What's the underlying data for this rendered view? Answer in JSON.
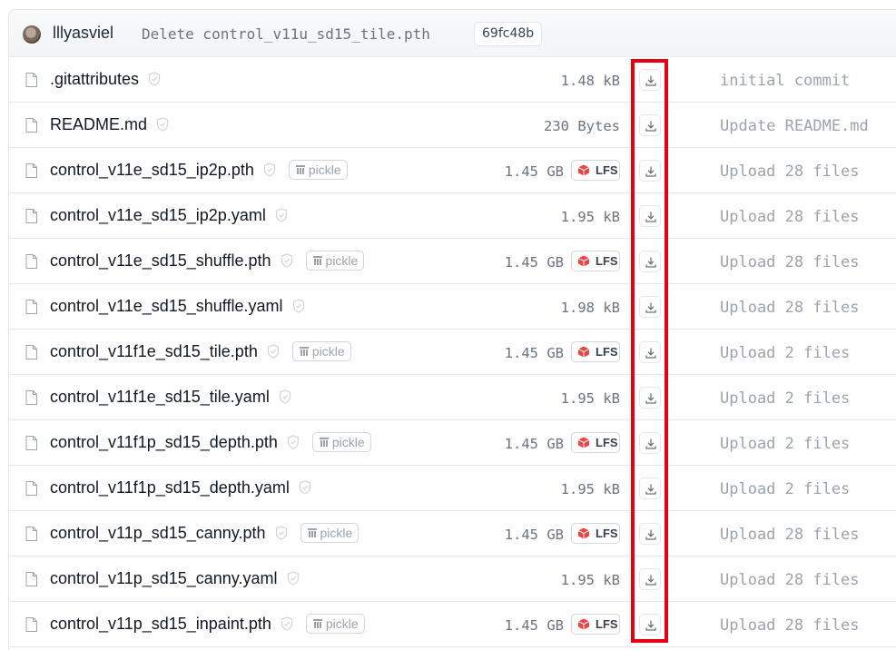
{
  "commit": {
    "author": "lllyasviel",
    "message": "Delete control_v11u_sd15_tile.pth",
    "hash": "69fc48b"
  },
  "badges": {
    "pickle_label": "pickle",
    "lfs_label": "LFS"
  },
  "files": [
    {
      "name": ".gitattributes",
      "size": "1.48 kB",
      "pickle": false,
      "lfs": false,
      "message": "initial commit"
    },
    {
      "name": "README.md",
      "size": "230 Bytes",
      "pickle": false,
      "lfs": false,
      "message": "Update README.md"
    },
    {
      "name": "control_v11e_sd15_ip2p.pth",
      "size": "1.45 GB",
      "pickle": true,
      "lfs": true,
      "message": "Upload 28 files"
    },
    {
      "name": "control_v11e_sd15_ip2p.yaml",
      "size": "1.95 kB",
      "pickle": false,
      "lfs": false,
      "message": "Upload 28 files"
    },
    {
      "name": "control_v11e_sd15_shuffle.pth",
      "size": "1.45 GB",
      "pickle": true,
      "lfs": true,
      "message": "Upload 28 files"
    },
    {
      "name": "control_v11e_sd15_shuffle.yaml",
      "size": "1.98 kB",
      "pickle": false,
      "lfs": false,
      "message": "Upload 28 files"
    },
    {
      "name": "control_v11f1e_sd15_tile.pth",
      "size": "1.45 GB",
      "pickle": true,
      "lfs": true,
      "message": "Upload 2 files"
    },
    {
      "name": "control_v11f1e_sd15_tile.yaml",
      "size": "1.95 kB",
      "pickle": false,
      "lfs": false,
      "message": "Upload 2 files"
    },
    {
      "name": "control_v11f1p_sd15_depth.pth",
      "size": "1.45 GB",
      "pickle": true,
      "lfs": true,
      "message": "Upload 2 files"
    },
    {
      "name": "control_v11f1p_sd15_depth.yaml",
      "size": "1.95 kB",
      "pickle": false,
      "lfs": false,
      "message": "Upload 2 files"
    },
    {
      "name": "control_v11p_sd15_canny.pth",
      "size": "1.45 GB",
      "pickle": true,
      "lfs": true,
      "message": "Upload 28 files"
    },
    {
      "name": "control_v11p_sd15_canny.yaml",
      "size": "1.95 kB",
      "pickle": false,
      "lfs": false,
      "message": "Upload 28 files"
    },
    {
      "name": "control_v11p_sd15_inpaint.pth",
      "size": "1.45 GB",
      "pickle": true,
      "lfs": true,
      "message": "Upload 28 files"
    }
  ],
  "colors": {
    "highlight": "#e60012",
    "lfs_icon": "#ef4444"
  }
}
